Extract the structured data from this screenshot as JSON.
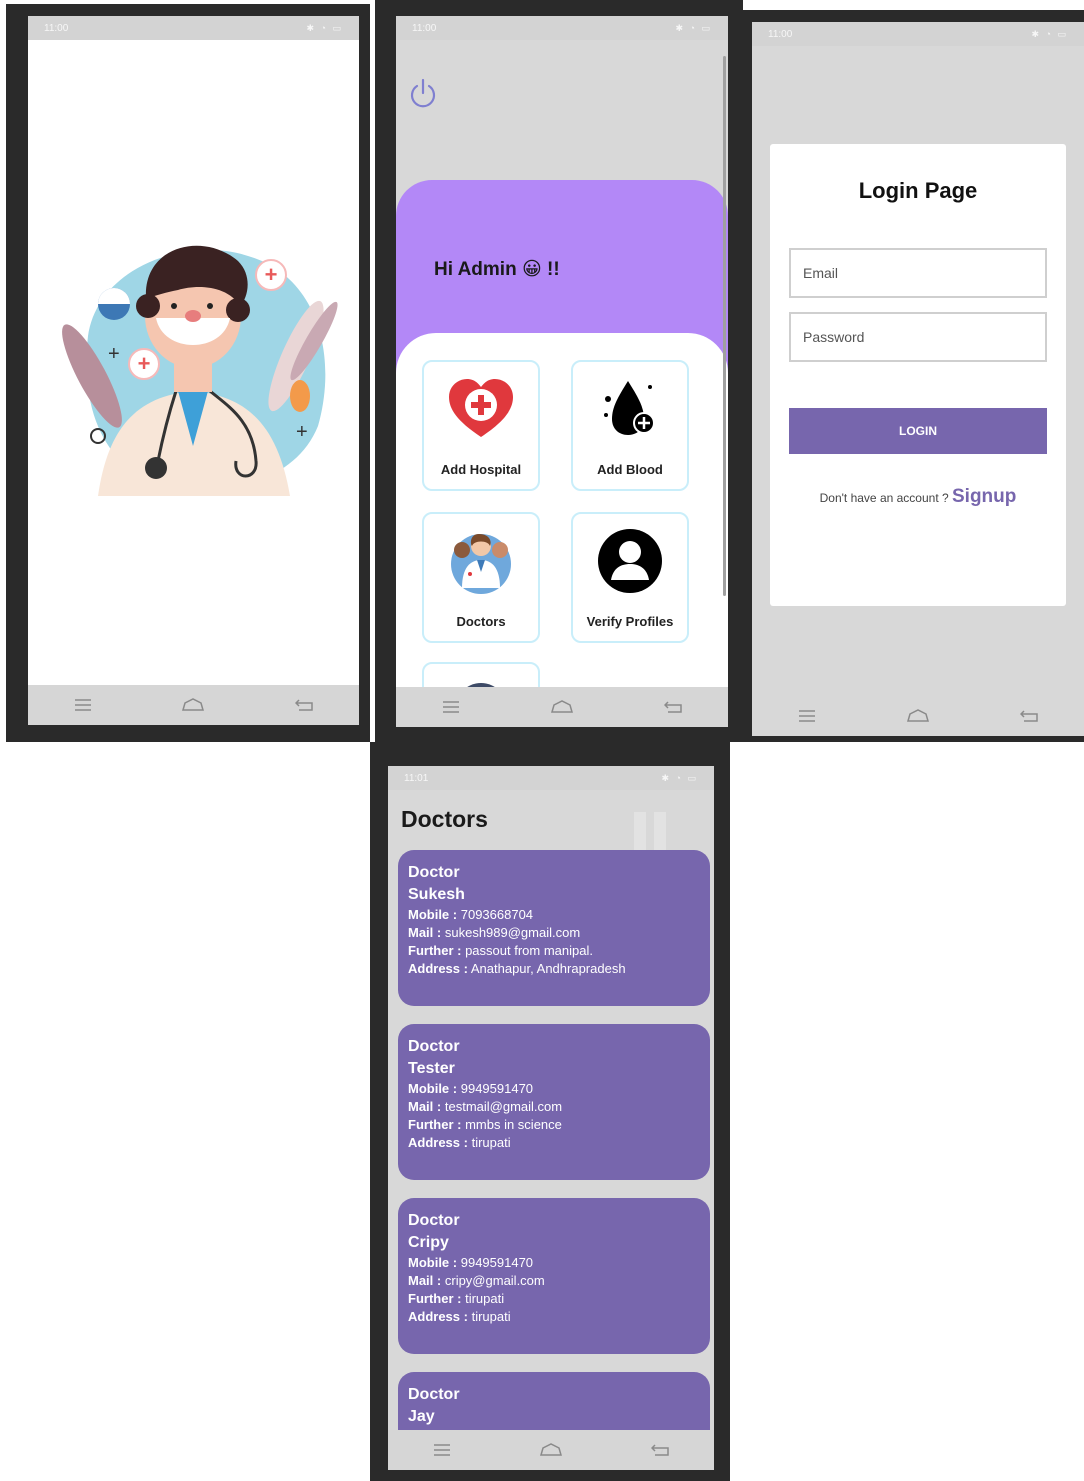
{
  "status_bar": {
    "splash_time": "11:00",
    "admin_time": "11:00",
    "login_time": "11:00",
    "doctors_time": "11:01"
  },
  "admin": {
    "greeting": "Hi Admin 😀 !!",
    "tiles": [
      {
        "label": "Add Hospital",
        "icon": "heart-plus-icon"
      },
      {
        "label": "Add Blood",
        "icon": "blood-drop-plus-icon"
      },
      {
        "label": "Doctors",
        "icon": "doctors-group-icon"
      },
      {
        "label": "Verify Profiles",
        "icon": "user-profile-icon"
      }
    ]
  },
  "login": {
    "title": "Login Page",
    "email_placeholder": "Email",
    "password_placeholder": "Password",
    "button_label": "LOGIN",
    "no_account_text": "Don't have an account ?",
    "signup_label": "Signup"
  },
  "doctors": {
    "title": "Doctors",
    "field_labels": {
      "mobile": "Mobile :",
      "mail": "Mail :",
      "further": "Further :",
      "address": "Address :"
    },
    "list": [
      {
        "prefix": "Doctor",
        "name": "Sukesh",
        "mobile": "7093668704",
        "mail": "sukesh989@gmail.com",
        "further": "passout from manipal.",
        "address": "Anathapur, Andhrapradesh"
      },
      {
        "prefix": "Doctor",
        "name": "Tester",
        "mobile": "9949591470",
        "mail": "testmail@gmail.com",
        "further": "mmbs in science",
        "address": "tirupati"
      },
      {
        "prefix": "Doctor",
        "name": "Cripy",
        "mobile": "9949591470",
        "mail": "cripy@gmail.com",
        "further": "tirupati",
        "address": "tirupati"
      },
      {
        "prefix": "Doctor",
        "name": "Jay"
      }
    ]
  },
  "colors": {
    "accent_purple": "#7766ad",
    "light_purple": "#b388f7",
    "tile_border": "#c9eefa",
    "screen_gray": "#d8d8d8"
  }
}
